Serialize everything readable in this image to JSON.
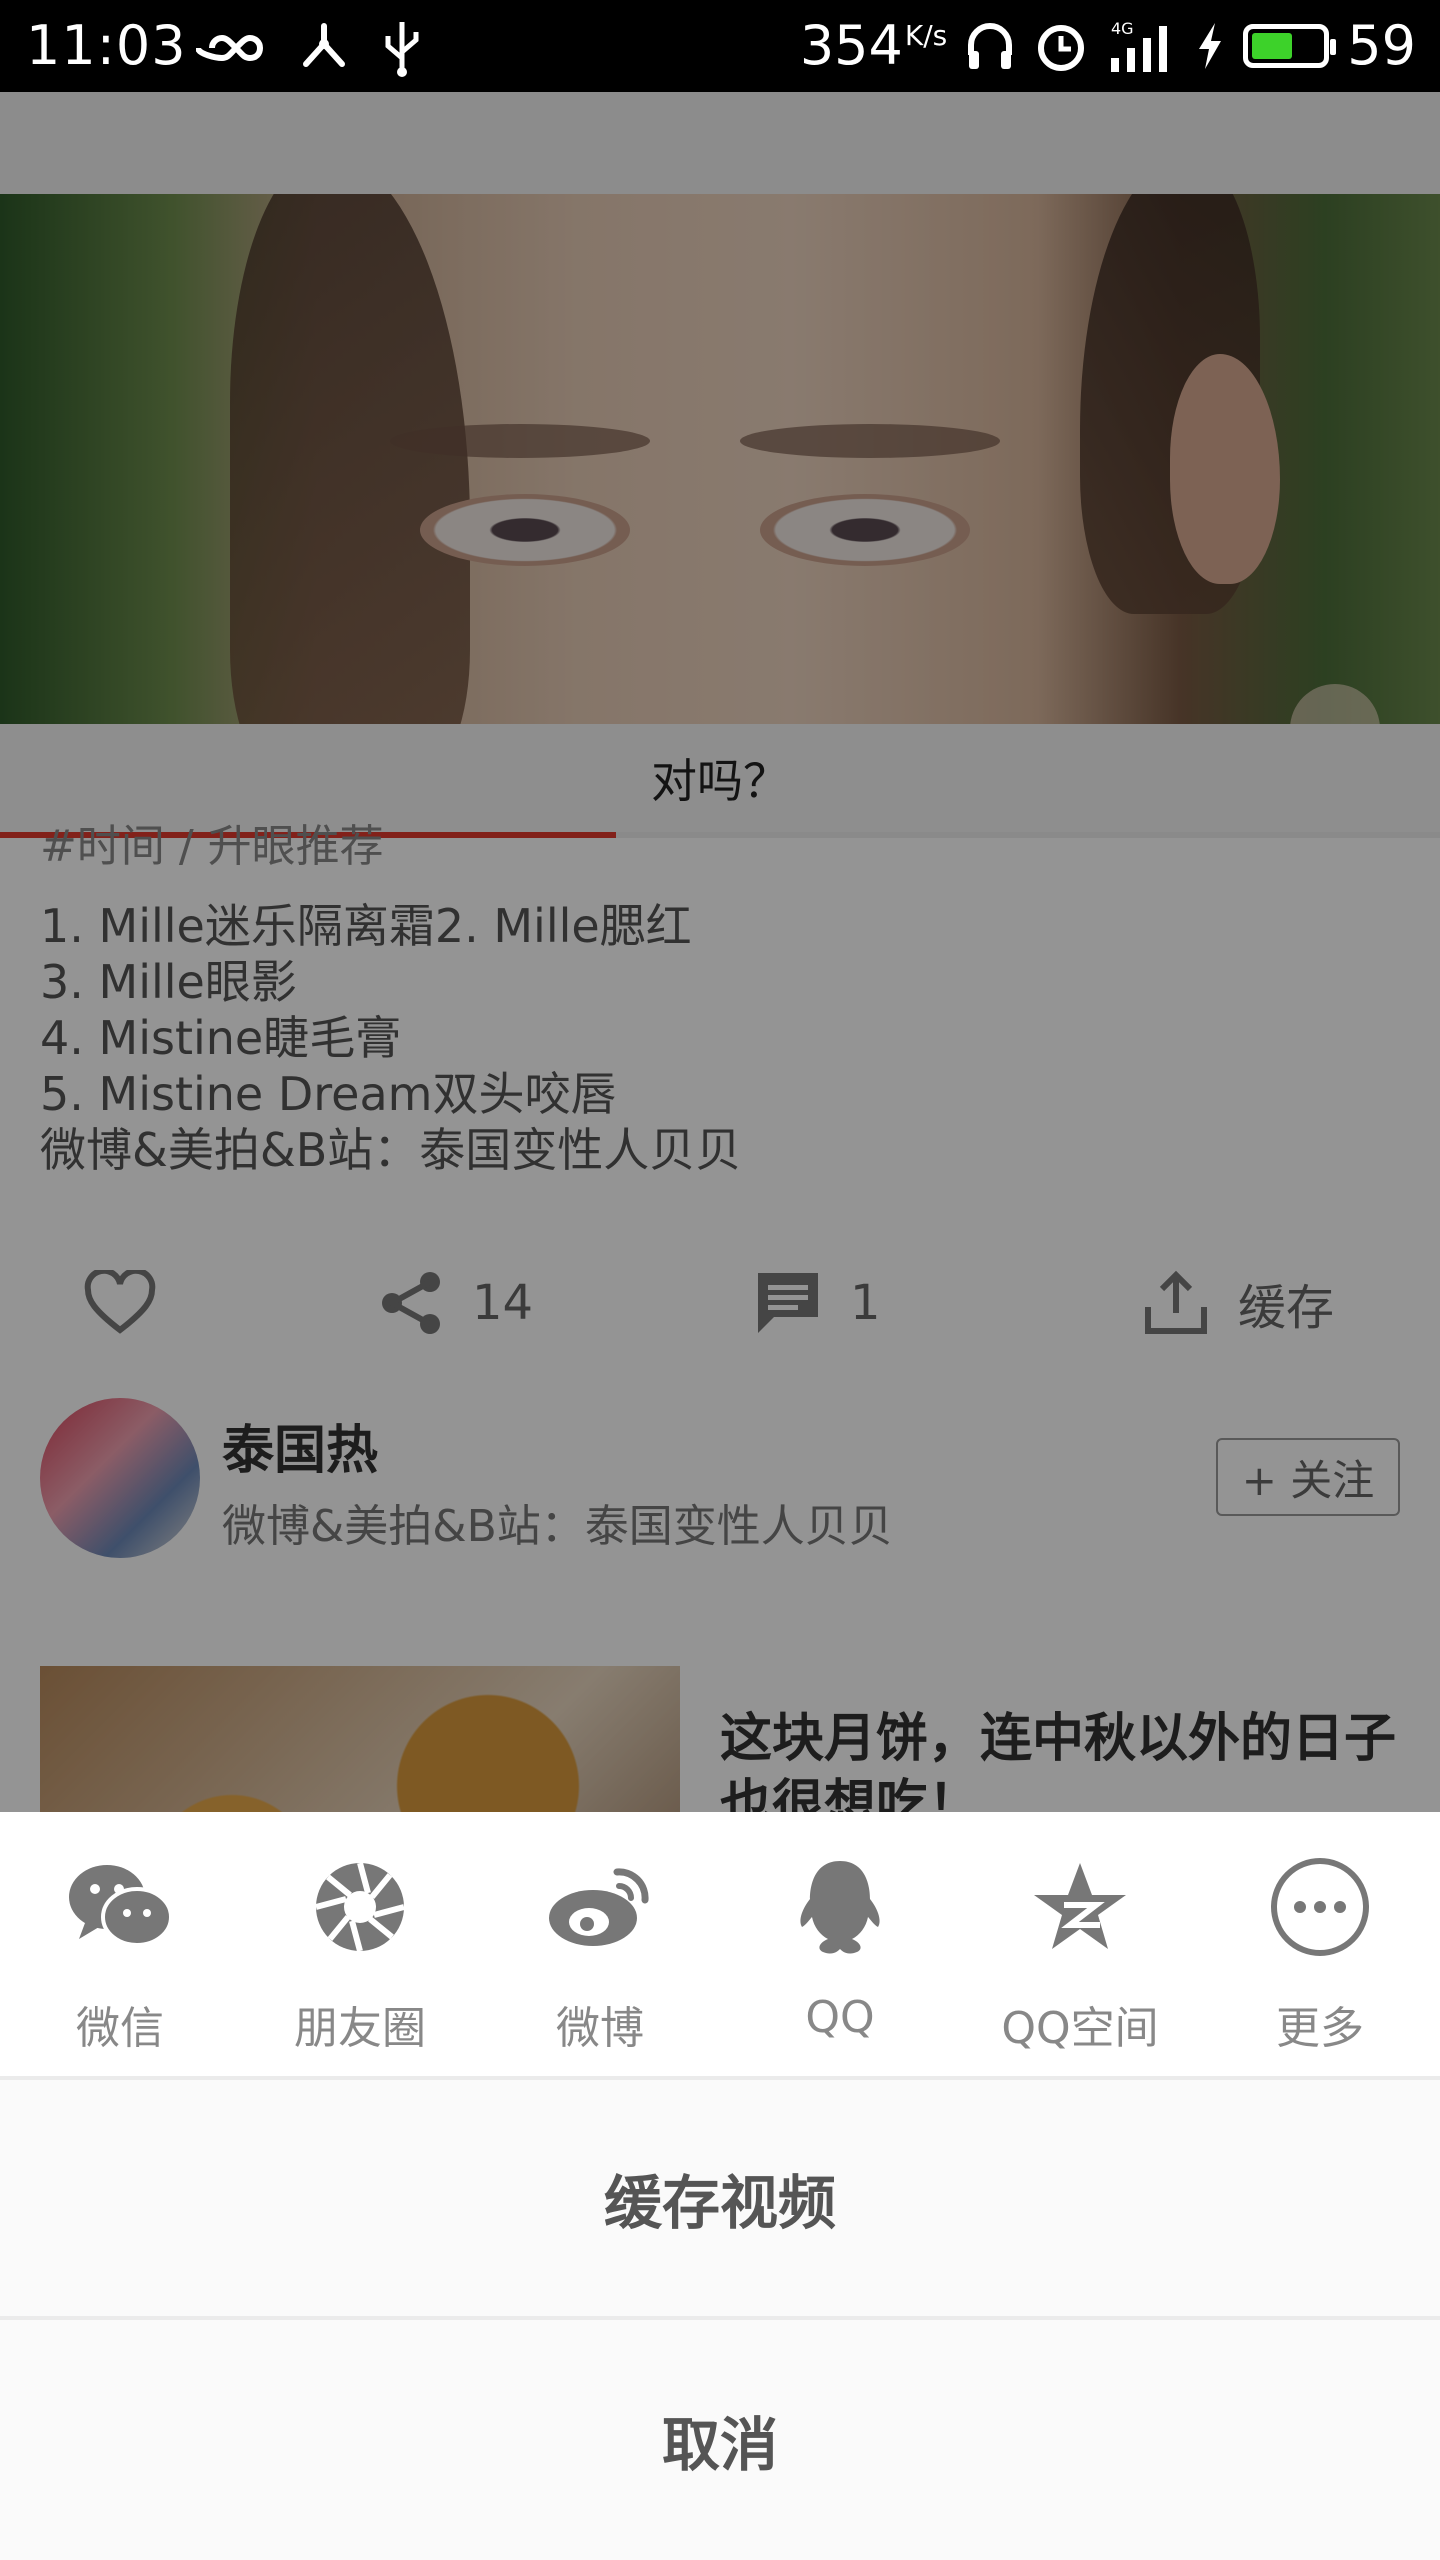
{
  "status_bar": {
    "time": "11:03",
    "net_speed": "354",
    "net_speed_unit": "K/s",
    "network_type": "4G",
    "battery_percent": "59",
    "battery_fill": 0.59,
    "battery_color": "#3dd22a"
  },
  "video": {
    "subtitle": "对吗？",
    "progress_fraction": 0.428,
    "progress_color": "#e03a2e"
  },
  "post": {
    "hashtag": "#时间 / 升眼推荐",
    "description_lines": [
      "1. Mille迷乐隔离霜2. Mille腮红",
      "3. Mille眼影",
      "4. Mistine睫毛膏",
      "5. Mistine Dream双头咬唇",
      "微博&美拍&B站：泰国变性人贝贝"
    ],
    "actions": {
      "like_icon": "heart-icon",
      "share_icon": "share-icon",
      "share_count": "14",
      "comment_icon": "comment-icon",
      "comment_count": "1",
      "cache_icon": "upload-icon",
      "cache_label": "缓存"
    },
    "author": {
      "name": "泰国热",
      "bio": "微博&美拍&B站：泰国变性人贝贝",
      "follow_label": "+ 关注"
    },
    "recommendation": {
      "title": "这块月饼，连中秋以外的日子也很想吃！"
    }
  },
  "share_sheet": {
    "targets": [
      {
        "label": "微信",
        "icon": "wechat-icon"
      },
      {
        "label": "朋友圈",
        "icon": "moments-icon"
      },
      {
        "label": "微博",
        "icon": "weibo-icon"
      },
      {
        "label": "QQ",
        "icon": "qq-icon"
      },
      {
        "label": "QQ空间",
        "icon": "qzone-icon"
      },
      {
        "label": "更多",
        "icon": "more-icon"
      }
    ],
    "cache_video_label": "缓存视频",
    "cancel_label": "取消"
  }
}
